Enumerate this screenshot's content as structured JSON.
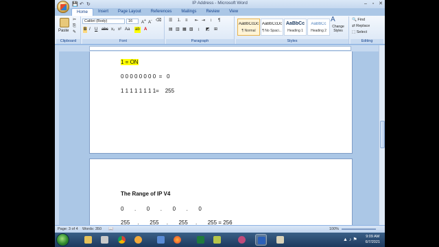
{
  "window": {
    "title": "IP Address - Microsoft Word"
  },
  "tabs": [
    "Home",
    "Insert",
    "Page Layout",
    "References",
    "Mailings",
    "Review",
    "View"
  ],
  "ribbon": {
    "clipboard": {
      "label": "Clipboard",
      "paste": "Paste"
    },
    "font": {
      "label": "Font",
      "name": "Calibri (Body)",
      "size": "16"
    },
    "paragraph": {
      "label": "Paragraph"
    },
    "styles": {
      "label": "Styles",
      "items": [
        {
          "sample": "AaBbCcDc",
          "name": "¶ Normal"
        },
        {
          "sample": "AaBbCcDc",
          "name": "¶ No Spaci..."
        },
        {
          "sample": "AaBbCc",
          "name": "Heading 1"
        },
        {
          "sample": "AaBbCc",
          "name": "Heading 2"
        }
      ],
      "change_styles": "Change Styles"
    },
    "editing": {
      "label": "Editing",
      "find": "Find",
      "replace": "Replace",
      "select": "Select"
    }
  },
  "document": {
    "page1": {
      "line1": "1 = ON",
      "line2": "0 0 0 0 0 0 0 0  =   0",
      "line3": "1 1 1 1 1 1 1 1=    255"
    },
    "page2": {
      "heading": "The Range of IP V4",
      "row1": "0       .       0       .       0       .       0",
      "row2": "255     .       255     .       255     .       255 = 256"
    }
  },
  "statusbar": {
    "page": "Page: 3 of 4",
    "words": "Words: 350",
    "zoom": "100%"
  },
  "taskbar": {
    "time": "9:09 AM",
    "date": "6/7/2021"
  },
  "colors": {
    "accent": "#15428b",
    "highlight": "#ffff00"
  }
}
